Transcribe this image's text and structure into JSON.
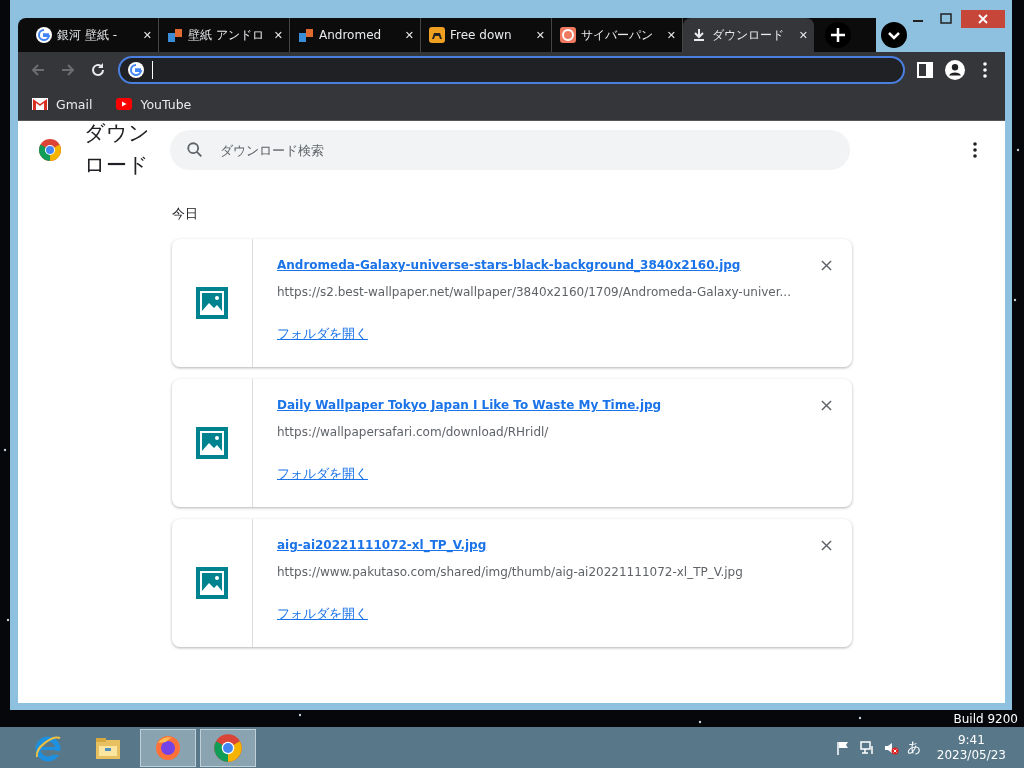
{
  "desktop": {
    "watermark": "Build 9200"
  },
  "tabs": [
    {
      "title": "銀河 壁紙 -",
      "close": "✕",
      "selected": false
    },
    {
      "title": "壁紙 アンドロ",
      "close": "✕",
      "selected": false
    },
    {
      "title": "Andromed",
      "close": "✕",
      "selected": false
    },
    {
      "title": "Free down",
      "close": "✕",
      "selected": false
    },
    {
      "title": "サイバーパン",
      "close": "✕",
      "selected": false
    },
    {
      "title": "ダウンロード",
      "close": "✕",
      "selected": true
    }
  ],
  "bookmarks": [
    {
      "label": "Gmail"
    },
    {
      "label": "YouTube"
    }
  ],
  "page": {
    "title": "ダウンロード",
    "search": {
      "placeholder": "ダウンロード検索"
    },
    "section": "今日",
    "downloads": [
      {
        "file": "Andromeda-Galaxy-universe-stars-black-background_3840x2160.jpg",
        "url": "https://s2.best-wallpaper.net/wallpaper/3840x2160/1709/Andromeda-Galaxy-univer...",
        "action": "フォルダを開く"
      },
      {
        "file": "Daily Wallpaper Tokyo Japan I Like To Waste My Time.jpg",
        "url": "https://wallpapersafari.com/download/RHridl/",
        "action": "フォルダを開く"
      },
      {
        "file": "aig-ai20221111072-xl_TP_V.jpg",
        "url": "https://www.pakutaso.com/shared/img/thumb/aig-ai20221111072-xl_TP_V.jpg",
        "action": "フォルダを開く"
      }
    ]
  },
  "taskbar": {
    "apps": [
      {
        "selected": false
      },
      {
        "selected": false
      },
      {
        "selected": true
      },
      {
        "selected": true
      }
    ],
    "tray": {
      "ime": "あ",
      "time": "9:41",
      "date": "2023/05/23"
    }
  }
}
